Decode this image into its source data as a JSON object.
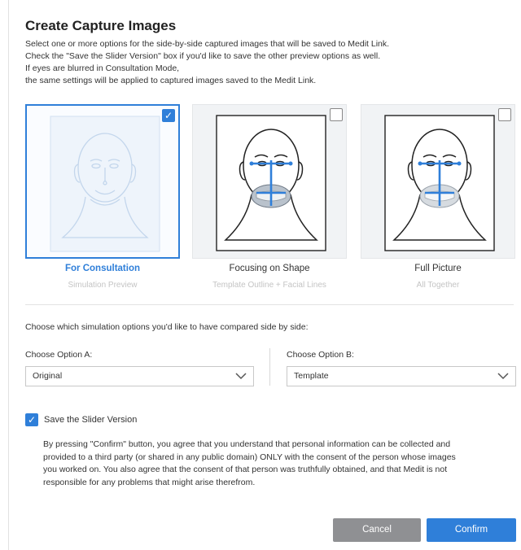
{
  "dialog": {
    "title": "Create Capture Images",
    "intro_lines": [
      "Select one or more options for the side-by-side captured images that will be saved to Medit Link.",
      "Check the \"Save the Slider Version\" box if you'd like to save the other preview options as well.",
      "If eyes are blurred in Consultation Mode,",
      "the same settings will be applied to captured images saved to the Medit Link."
    ]
  },
  "cards": [
    {
      "label": "For Consultation",
      "sublabel": "Simulation Preview",
      "checked": true,
      "thumb_icon": "face-outline-icon"
    },
    {
      "label": "Focusing on Shape",
      "sublabel": "Template Outline + Facial Lines",
      "checked": false,
      "thumb_icon": "face-template-lines-icon"
    },
    {
      "label": "Full Picture",
      "sublabel": "All Together",
      "checked": false,
      "thumb_icon": "face-full-picture-icon"
    }
  ],
  "comparison": {
    "prompt": "Choose which simulation options you'd like to have compared side by side:",
    "option_a": {
      "label": "Choose Option A:",
      "value": "Original"
    },
    "option_b": {
      "label": "Choose Option B:",
      "value": "Template"
    }
  },
  "slider": {
    "label": "Save the Slider Version",
    "checked": true
  },
  "consent_lines": [
    "By pressing \"Confirm\" button, you agree that you understand that personal information can be collected and",
    "provided to a third party (or shared in any public domain) ONLY with the consent of the person whose images",
    "you worked on. You also agree that the consent of that person was truthfully obtained, and that Medit is not",
    "responsible for any problems that might arise therefrom."
  ],
  "buttons": {
    "cancel": "Cancel",
    "confirm": "Confirm"
  },
  "colors": {
    "accent": "#2f7fd9",
    "cancel_bg": "#8f9093",
    "template_line": "#2f7fd9"
  }
}
